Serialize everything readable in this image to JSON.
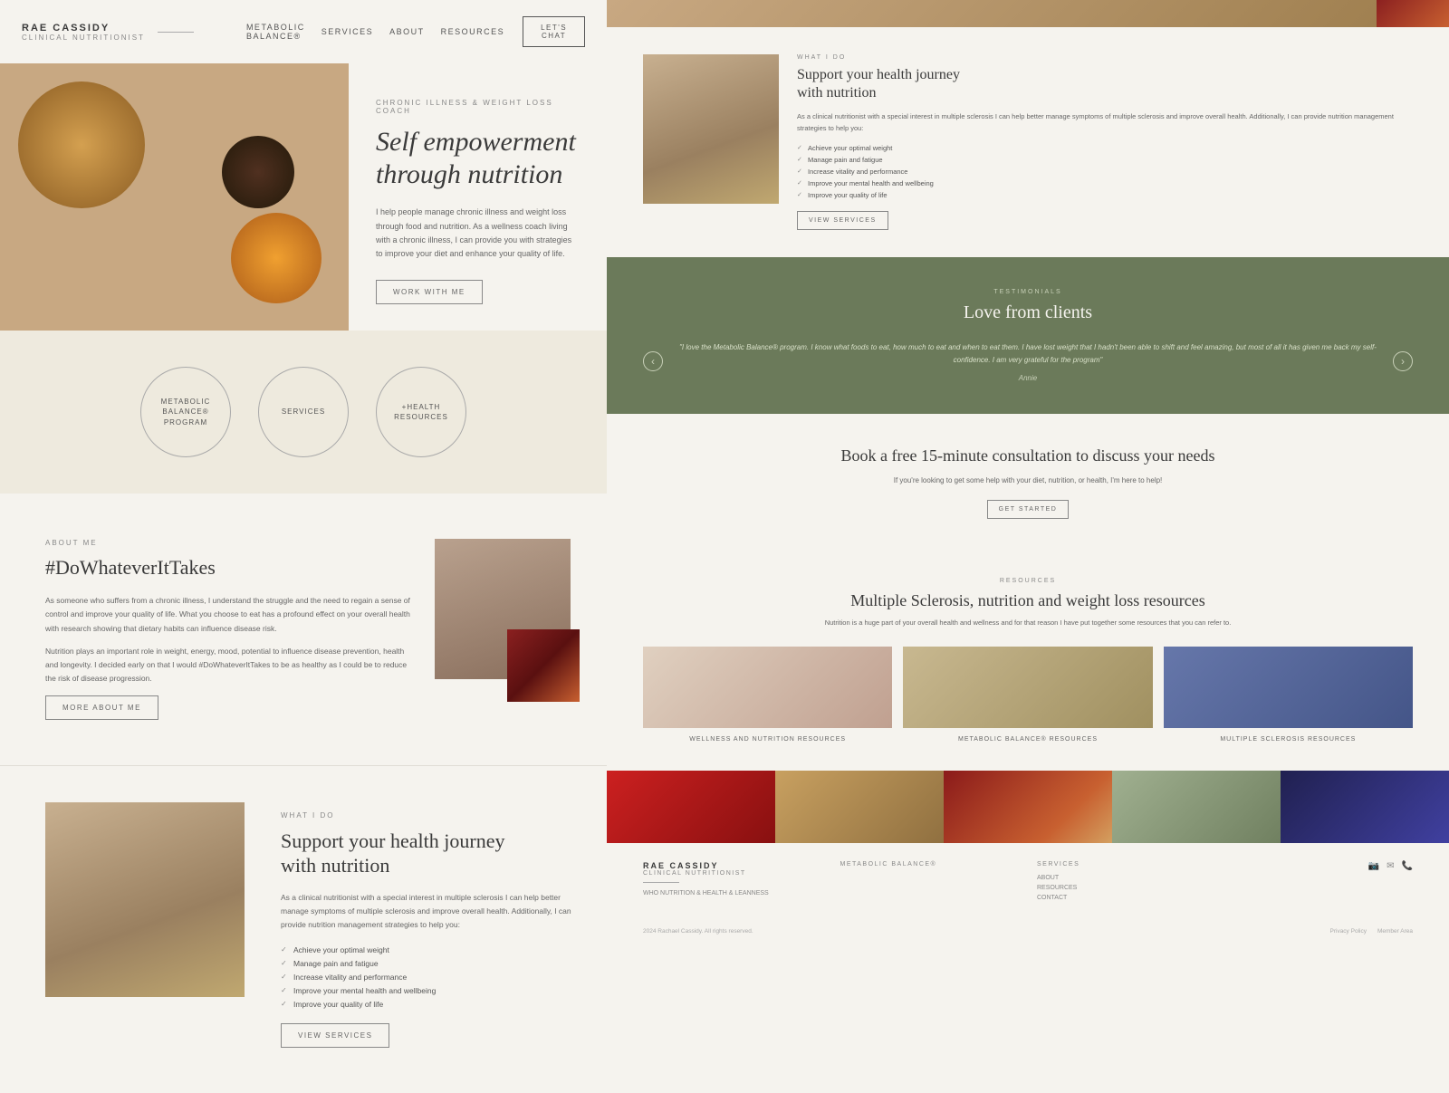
{
  "brand": {
    "name": "RAE CASSIDY",
    "subtitle": "CLINICAL NUTRITIONIST",
    "divider": "—"
  },
  "nav": {
    "links": [
      {
        "label": "METABOLIC BALANCE®",
        "id": "metabolic-balance"
      },
      {
        "label": "SERVICES",
        "id": "services"
      },
      {
        "label": "ABOUT",
        "id": "about"
      },
      {
        "label": "RESOURCES",
        "id": "resources"
      }
    ],
    "cta": "LET'S CHAT"
  },
  "hero": {
    "tag": "CHRONIC ILLNESS & WEIGHT LOSS COACH",
    "title": "Self empowerment through nutrition",
    "description": "I help people manage chronic illness and weight loss through food and nutrition. As a wellness coach living with a chronic illness, I can provide you with strategies to improve your diet and enhance your quality of life.",
    "cta": "WORK WITH ME"
  },
  "circles": [
    {
      "label": "METABOLIC\nBALANCE®\nPROGRAM"
    },
    {
      "label": "SERVICES"
    },
    {
      "label": "+HEALTH\nRESOURCES"
    }
  ],
  "about": {
    "tag": "ABOUT ME",
    "title": "#DoWhateverItTakes",
    "desc1": "As someone who suffers from a chronic illness, I understand the struggle and the need to regain a sense of control and improve your quality of life. What you choose to eat has a profound effect on your overall health with research showing that dietary habits can influence disease risk.",
    "desc2": "Nutrition plays an important role in weight, energy, mood, potential to influence disease prevention, health and longevity. I decided early on that I would #DoWhateverItTakes to be as healthy as I could be to reduce the risk of disease progression.",
    "cta": "MORE ABOUT ME"
  },
  "what_i_do_left": {
    "tag": "WHAT I DO",
    "title": "Support your health journey\nwith nutrition",
    "description": "As a clinical nutritionist with a special interest in multiple sclerosis I can help better manage symptoms of multiple sclerosis and improve overall health. Additionally, I can provide nutrition management strategies to help you:",
    "list": [
      "Achieve your optimal weight",
      "Manage pain and fatigue",
      "Increase vitality and performance",
      "Improve your mental health and wellbeing",
      "Improve your quality of life"
    ],
    "cta": "VIEW SERVICES"
  },
  "what_i_do_right": {
    "tag": "WHAT I DO",
    "title": "Support your health journey\nwith nutrition",
    "description": "As a clinical nutritionist with a special interest in multiple sclerosis I can help better manage symptoms of multiple sclerosis and improve overall health. Additionally, I can provide nutrition management strategies to help you:",
    "list": [
      "Achieve your optimal weight",
      "Manage pain and fatigue",
      "Increase vitality and performance",
      "Improve your mental health and wellbeing",
      "Improve your quality of life"
    ],
    "cta": "VIEW SERVICES"
  },
  "testimonials": {
    "tag": "TESTIMONIALS",
    "title": "Love from clients",
    "quote": "\"I love the Metabolic Balance® program. I know what foods to eat, how much to eat and when to eat them. I have lost weight that I hadn't been able to shift and feel amazing, but most of all it has given me back my self-confidence. I am very grateful for the program\"",
    "author": "Annie"
  },
  "consultation": {
    "title": "Book a free 15-minute consultation to discuss your needs",
    "description": "If you're looking to get some help with your diet, nutrition, or health, I'm here to help!",
    "cta": "GET STARTED"
  },
  "resources": {
    "tag": "RESOURCES",
    "title": "Multiple Sclerosis, nutrition and weight loss resources",
    "description": "Nutrition is a huge part of your overall health and wellness and for that reason I have put together some resources that you can refer to.",
    "cards": [
      {
        "label": "WELLNESS AND NUTRITION RESOURCES"
      },
      {
        "label": "METABOLIC BALANCE® RESOURCES"
      },
      {
        "label": "MULTIPLE SCLEROSIS RESOURCES"
      }
    ]
  },
  "footer": {
    "logo_name": "RAE CASSIDY",
    "logo_sub": "CLINICAL NUTRITIONIST",
    "logo_tagline": "WHO NUTRITION & HEALTH\n& LEANNESS",
    "columns": [
      {
        "title": "METABOLIC BALANCE®",
        "links": []
      },
      {
        "title": "SERVICES",
        "links": [
          {
            "label": "ABOUT"
          },
          {
            "label": "RESOURCES"
          },
          {
            "label": "CONTACT"
          }
        ]
      }
    ],
    "copyright": "2024 Rachael Cassidy. All rights reserved.",
    "policy_links": [
      {
        "label": "Privacy Policy"
      },
      {
        "label": "Member Area"
      }
    ]
  }
}
